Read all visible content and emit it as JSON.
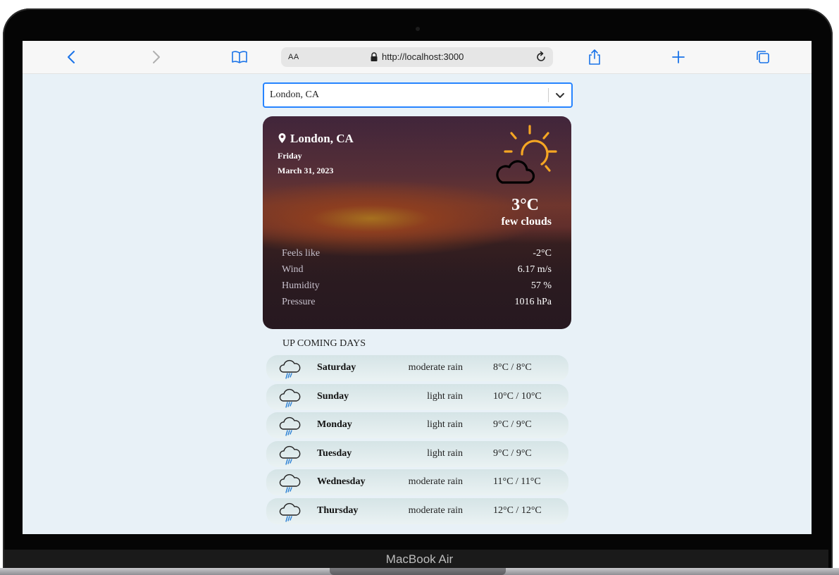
{
  "browser": {
    "url_aa": "AA",
    "url": "http://localhost:3000"
  },
  "search": {
    "selected_city": "London, CA"
  },
  "current": {
    "location": "London, CA",
    "day": "Friday",
    "date": "March 31, 2023",
    "temperature": "3°C",
    "description": "few clouds",
    "icon": "partly-cloudy-sun-icon",
    "details": [
      {
        "label": "Feels like",
        "value": "-2°C"
      },
      {
        "label": "Wind",
        "value": "6.17 m/s"
      },
      {
        "label": "Humidity",
        "value": "57 %"
      },
      {
        "label": "Pressure",
        "value": "1016 hPa"
      }
    ]
  },
  "forecast": {
    "title": "UP COMING DAYS",
    "days": [
      {
        "day": "Saturday",
        "description": "moderate rain",
        "temp": "8°C / 8°C",
        "icon": "rain-cloud-icon"
      },
      {
        "day": "Sunday",
        "description": "light rain",
        "temp": "10°C / 10°C",
        "icon": "rain-cloud-icon"
      },
      {
        "day": "Monday",
        "description": "light rain",
        "temp": "9°C / 9°C",
        "icon": "rain-cloud-icon"
      },
      {
        "day": "Tuesday",
        "description": "light rain",
        "temp": "9°C / 9°C",
        "icon": "rain-cloud-icon"
      },
      {
        "day": "Wednesday",
        "description": "moderate rain",
        "temp": "11°C / 11°C",
        "icon": "rain-cloud-icon"
      },
      {
        "day": "Thursday",
        "description": "moderate rain",
        "temp": "12°C / 12°C",
        "icon": "rain-cloud-icon"
      }
    ]
  },
  "device": {
    "label": "MacBook Air"
  },
  "colors": {
    "accent": "#2684ff",
    "sun": "#f5a623",
    "rain": "#2a7fd4"
  }
}
